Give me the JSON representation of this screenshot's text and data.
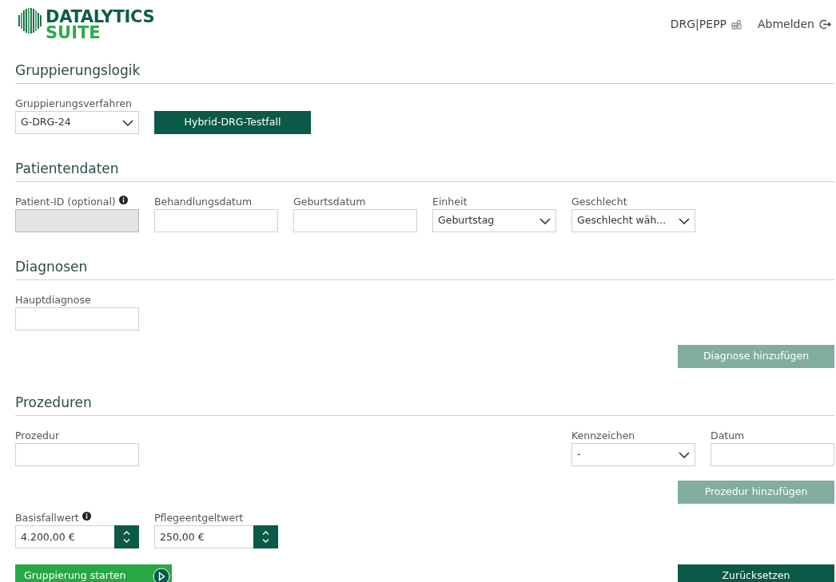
{
  "logo": {
    "line1": "DATALYTICS",
    "line2": "SUITE"
  },
  "header_links": [
    {
      "label": "DRG|PEPP",
      "kind": "modules"
    },
    {
      "label": "Abmelden",
      "kind": "logout"
    }
  ],
  "sections": [
    {
      "title": "Gruppierungslogik",
      "fields": [
        {
          "label": "Gruppierungsverfahren",
          "kind": "select",
          "value": "G-DRG-24",
          "disabled": false,
          "info": false
        },
        {
          "label": "Hybrid-DRG-Testfall",
          "kind": "button",
          "disabled": false
        }
      ]
    },
    {
      "title": "Patientendaten",
      "fields": [
        {
          "label": "Patient-ID (optional)",
          "kind": "text",
          "disabled": true,
          "info": true
        },
        {
          "label": "Behandlungsdatum",
          "kind": "text",
          "disabled": false,
          "info": false
        },
        {
          "label": "Geburtsdatum",
          "kind": "text",
          "disabled": false,
          "info": false
        },
        {
          "label": "Einheit",
          "kind": "select",
          "value": "Geburtstag",
          "disabled": false,
          "info": false
        },
        {
          "label": "Geschlecht",
          "kind": "select",
          "value": "Geschlecht wäh...",
          "disabled": false,
          "info": false
        }
      ]
    },
    {
      "title": "Diagnosen",
      "fields": [
        {
          "label": "Hauptdiagnose",
          "kind": "text",
          "disabled": false,
          "info": false
        }
      ],
      "action": {
        "label": "Diagnose hinzufügen",
        "disabled": true
      }
    },
    {
      "title": "Prozeduren",
      "fields": [
        {
          "label": "Prozedur",
          "kind": "text",
          "disabled": false,
          "info": false
        }
      ],
      "fields_right": [
        {
          "label": "Kennzeichen",
          "kind": "select",
          "value": "-",
          "disabled": false,
          "info": false
        },
        {
          "label": "Datum",
          "kind": "text",
          "disabled": false,
          "info": false
        }
      ],
      "action": {
        "label": "Prozedur hinzufügen",
        "disabled": true
      }
    }
  ],
  "rates": [
    {
      "label": "Basisfallwert",
      "kind": "number",
      "value": "4.200,00 €",
      "disabled": false,
      "info": true
    },
    {
      "label": "Pflegeentgeltwert",
      "kind": "number",
      "value": "250,00 €",
      "disabled": false,
      "info": false
    }
  ],
  "start_button": {
    "label": "Gruppierung starten"
  },
  "reset_button": {
    "label": "Zurücksetzen"
  }
}
